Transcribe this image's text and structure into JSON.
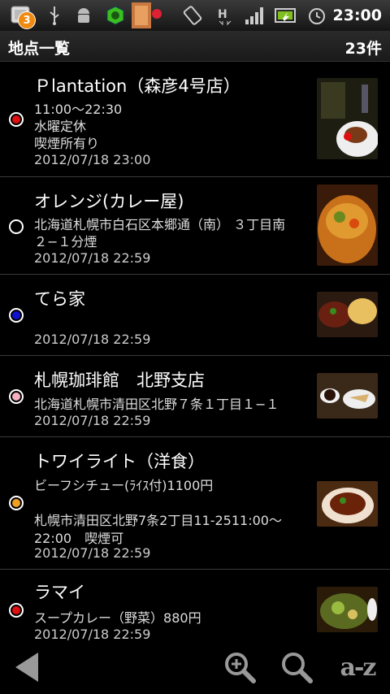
{
  "status_bar": {
    "notification_count": "3",
    "time": "23:00",
    "icons": [
      "notification-icon",
      "usb-icon",
      "android-debug-icon",
      "app-icon",
      "app-icon-2",
      "rotate-icon",
      "h-data-icon",
      "signal-icon",
      "battery-icon",
      "alarm-icon"
    ]
  },
  "header": {
    "title": "地点一覧",
    "count": "23件"
  },
  "items": [
    {
      "name": "Ｐlantation（森彦4号店）",
      "lines": [
        "11:00〜22:30",
        "水曜定休",
        "喫煙所有り"
      ],
      "date": "2012/07/18 23:00",
      "marker_color": "#e01010"
    },
    {
      "name": "オレンジ(カレー屋)",
      "lines": [
        "北海道札幌市白石区本郷通（南） ３丁目南",
        "２−１分煙"
      ],
      "date": "2012/07/18 22:59",
      "marker_color": "#000000"
    },
    {
      "name": "てら家",
      "lines": [],
      "date": "2012/07/18 22:59",
      "marker_color": "#1010d0"
    },
    {
      "name": "札幌珈琲館　北野支店",
      "lines": [
        "北海道札幌市清田区北野７条１丁目１−１"
      ],
      "date": "2012/07/18 22:59",
      "marker_color": "#f4b0c0"
    },
    {
      "name": "トワイライト（洋食）",
      "lines": [
        "ビーフシチュー(ﾗｲｽ付)1100円",
        "",
        "札幌市清田区北野7条2丁目11-2511:00〜",
        "22:00　喫煙可"
      ],
      "date": "2012/07/18 22:59",
      "marker_color": "#f0a020"
    },
    {
      "name": "ラマイ",
      "lines": [
        "スープカレー（野菜）880円"
      ],
      "date": "2012/07/18 22:59",
      "marker_color": "#e01010"
    }
  ],
  "toolbar": {
    "back_icon": "back-arrow-icon",
    "zoom_icon": "zoom-in-icon",
    "search_icon": "search-icon",
    "sort_label": "a-z"
  }
}
